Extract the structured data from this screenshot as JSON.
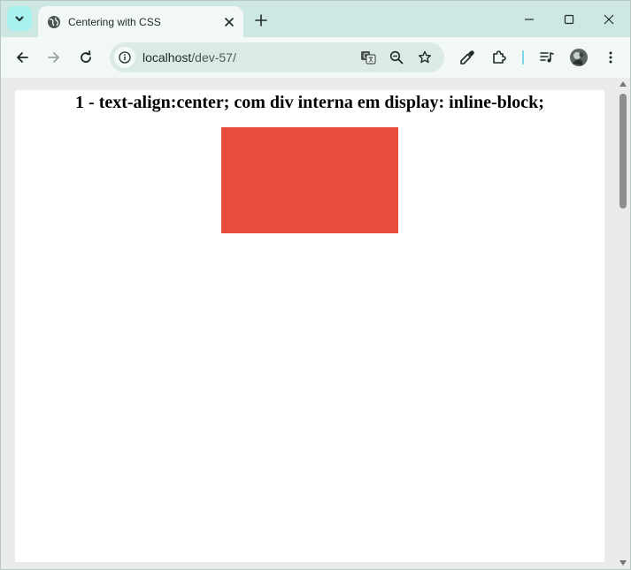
{
  "browser": {
    "tab": {
      "title": "Centering with CSS"
    },
    "address": {
      "host": "localhost",
      "path": "/dev-57/"
    },
    "colors": {
      "frame": "#cde8e2",
      "toolbar": "#f1f8f6",
      "omnibox": "#dbeae6"
    }
  },
  "page": {
    "heading": "1 - text-align:center; com div interna em display: inline-block;",
    "box_color": "#e74c3c"
  },
  "icons": {
    "tab_search": "chevron-down-icon",
    "favicon": "globe-icon",
    "tab_close": "close-icon",
    "new_tab": "plus-icon",
    "minimize": "minimize-icon",
    "maximize": "maximize-icon",
    "window_close": "close-icon",
    "back": "arrow-left-icon",
    "forward": "arrow-right-icon",
    "reload": "reload-icon",
    "site_info": "info-icon",
    "translate": "translate-icon",
    "zoom": "zoom-out-icon",
    "bookmark": "star-icon",
    "eyedropper": "eyedropper-icon",
    "extensions": "puzzle-icon",
    "media": "media-control-icon",
    "profile": "avatar-icon",
    "menu": "kebab-menu-icon"
  }
}
